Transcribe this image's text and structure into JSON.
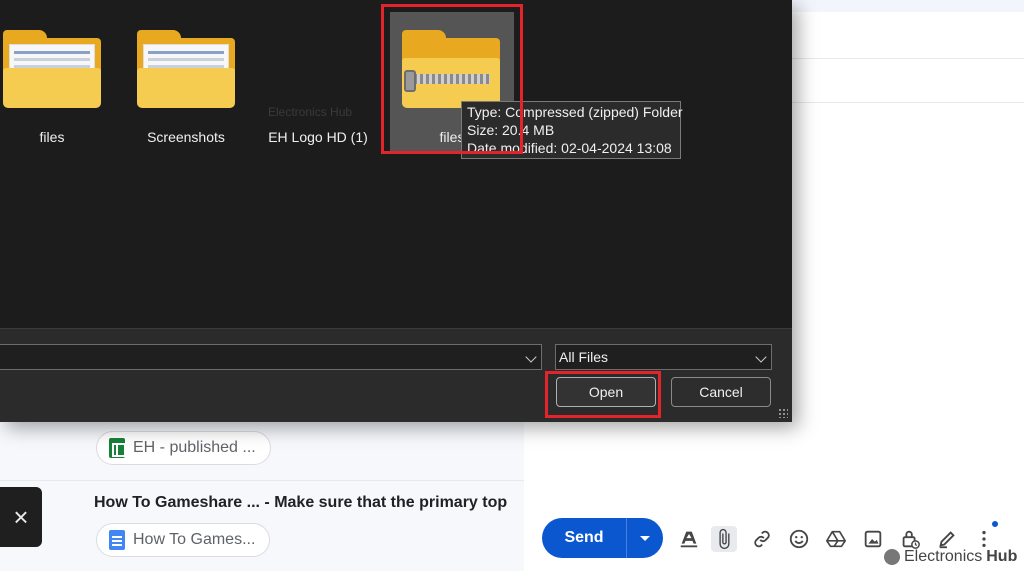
{
  "dialog": {
    "files": [
      {
        "label": "files",
        "kind": "folder"
      },
      {
        "label": "Screenshots",
        "kind": "folder"
      },
      {
        "label": "EH Logo HD (1)",
        "kind": "image"
      },
      {
        "label": "files",
        "kind": "zip-folder",
        "selected": true
      }
    ],
    "tooltip": {
      "type_line": "Type: Compressed (zipped) Folder",
      "size_line": "Size: 20.4 MB",
      "date_line": "Date modified: 02-04-2024 13:08"
    },
    "filename_value": "",
    "filetype_selected": "All Files",
    "open_label": "Open",
    "cancel_label": "Cancel",
    "faint_watermark": "Electronics Hub"
  },
  "gmail": {
    "chip_sheet": "EH - published ...",
    "mail_title": "How To Gameshare ... - Make sure that the primary top",
    "chip_doc": "How To Games...",
    "toast_close": "×",
    "send_label": "Send",
    "toolbar_icons": [
      "format-text-icon",
      "attach-icon",
      "link-icon",
      "emoji-icon",
      "drive-icon",
      "photo-icon",
      "confidential-lock-icon",
      "signature-pen-icon",
      "more-options-icon"
    ]
  },
  "watermark": {
    "brand_a": "Electronics",
    "brand_b": "Hub"
  },
  "colors": {
    "highlight": "#e3242b",
    "send_blue": "#0b57d0",
    "dialog_bg": "#1c1c1c",
    "folder_yellow": "#f6cc50"
  }
}
